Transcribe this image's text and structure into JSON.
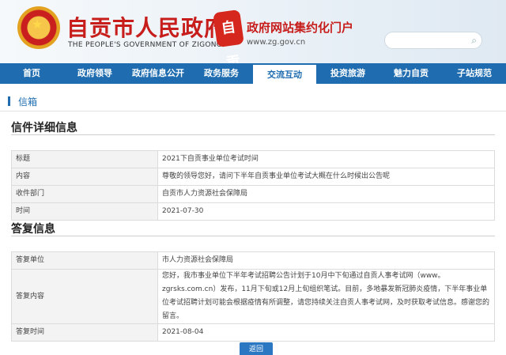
{
  "header": {
    "title": "自贡市人民政府",
    "subtitle": "THE PEOPLE'S GOVERNMENT OF ZIGONG",
    "logo_char": "自贡",
    "portal_name": "政府网站集约化门户",
    "portal_url": "www.zg.gov.cn"
  },
  "nav": {
    "items": [
      {
        "label": "首页"
      },
      {
        "label": "政府领导"
      },
      {
        "label": "政府信息公开"
      },
      {
        "label": "政务服务"
      },
      {
        "label": "交流互动"
      },
      {
        "label": "投资旅游"
      },
      {
        "label": "魅力自贡"
      },
      {
        "label": "子站规范"
      }
    ],
    "active_index": 4
  },
  "breadcrumb": "信箱",
  "letter": {
    "section_title": "信件详细信息",
    "rows": [
      {
        "key": "标题",
        "value": "2021下自贡事业单位考试时间"
      },
      {
        "key": "内容",
        "value": "尊敬的领导您好，请问下半年自贡事业单位考试大概在什么时候出公告呢"
      },
      {
        "key": "收件部门",
        "value": "自贡市人力资源社会保障局"
      },
      {
        "key": "时间",
        "value": "2021-07-30"
      }
    ]
  },
  "reply": {
    "section_title": "答复信息",
    "rows": [
      {
        "key": "答复单位",
        "value": "市人力资源社会保障局"
      },
      {
        "key": "答复内容",
        "value": "您好，我市事业单位下半年考试招聘公告计划于10月中下旬通过自贡人事考试网（www。zgrsks.com.cn）发布，11月下旬或12月上旬组织笔试。目前，多地暴发新冠肺炎疫情，下半年事业单位考试招聘计划可能会根据疫情有所调整，请您持续关注自贡人事考试网，及时获取考试信息。感谢您的留言。"
      },
      {
        "key": "答复时间",
        "value": "2021-08-04"
      }
    ]
  },
  "back_button": "返回",
  "colors": {
    "primary_blue": "#1f6db0",
    "title_red": "#c71e1c"
  }
}
